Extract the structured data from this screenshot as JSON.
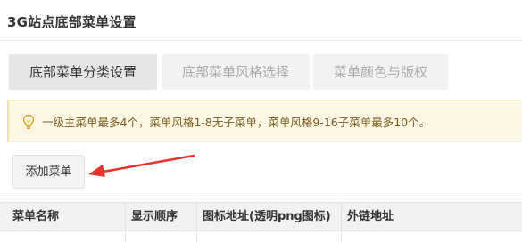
{
  "page": {
    "title": "3G站点底部菜单设置"
  },
  "tabs": [
    {
      "label": "底部菜单分类设置",
      "active": true
    },
    {
      "label": "底部菜单风格选择",
      "active": false
    },
    {
      "label": "菜单颜色与版权",
      "active": false
    }
  ],
  "notice": {
    "icon": "lightbulb-icon",
    "text": "一级主菜单最多4个，菜单风格1-8无子菜单，菜单风格9-16子菜单最多10个。"
  },
  "actions": {
    "add_label": "添加菜单"
  },
  "annotation": {
    "icon": "red-arrow-icon",
    "color": "#e8322b"
  },
  "table": {
    "columns": [
      "菜单名称",
      "显示顺序",
      "图标地址(透明png图标)",
      "外链地址"
    ]
  },
  "colors": {
    "notice_background": "#fcf8e3",
    "notice_text": "#7a5a1e",
    "tab_active_background": "#e6e6e6",
    "tab_inactive_text": "#aaaaaa",
    "header_background": "#f2f2f2"
  }
}
